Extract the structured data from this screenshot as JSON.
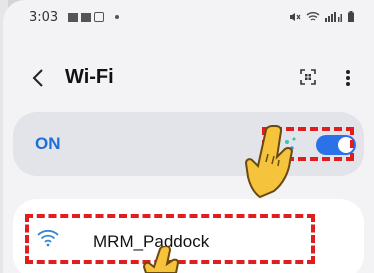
{
  "status_bar": {
    "time": "3:03",
    "left_icons": [
      "grid-notification-icon",
      "grid-notification-icon",
      "photo-notification-icon",
      "dot-icon"
    ],
    "right_icons": [
      "mute-icon",
      "wifi-signal-icon",
      "cell-signal-icon",
      "battery-icon"
    ]
  },
  "top_bar": {
    "back_icon": "chevron-left-icon",
    "title": "Wi-Fi",
    "qr_icon": "qr-scan-icon",
    "more_icon": "more-vertical-icon"
  },
  "wifi_toggle": {
    "label": "ON",
    "state": "on",
    "accent_color": "#1d6fd8"
  },
  "networks": [
    {
      "name": "MRM_Paddock",
      "icon": "wifi-icon"
    }
  ],
  "annotations": {
    "highlight_color": "#e21d1d",
    "pointer_icon": "hand-pointer-icon"
  }
}
